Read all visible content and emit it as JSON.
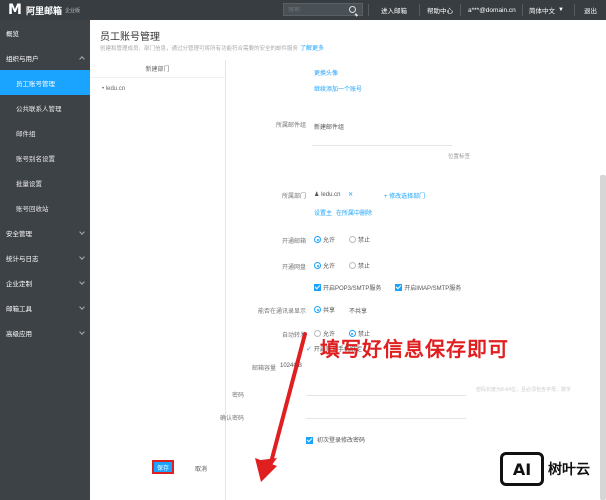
{
  "topbar": {
    "logo_mark": "M",
    "brand": "阿里邮箱",
    "edition": "企业版",
    "search_placeholder": "搜索",
    "nav": [
      "进入邮箱",
      "帮助中心",
      "a***@domain.cn",
      "简体中文",
      "退出"
    ]
  },
  "sidebar": {
    "items": [
      {
        "label": "概览"
      },
      {
        "label": "组织与用户",
        "expanded": true
      },
      {
        "label": "员工账号管理",
        "active": true
      },
      {
        "label": "公共联系人管理"
      },
      {
        "label": "邮件组"
      },
      {
        "label": "账号别名设置"
      },
      {
        "label": "批量设置"
      },
      {
        "label": "账号回收站"
      },
      {
        "label": "安全管理"
      },
      {
        "label": "统计与日志"
      },
      {
        "label": "企业定制"
      },
      {
        "label": "邮箱工具"
      },
      {
        "label": "高级应用"
      }
    ]
  },
  "main": {
    "title": "员工账号管理",
    "desc": "创建和管理成员、部门信息，通过分管理可将所有功能符合需要的安全的邮件服务",
    "desc_link": "了解更多",
    "dept_header": "新建部门",
    "dept_tree_root": "ledu.cn",
    "links_top": [
      "更换头像",
      "继续添加一个账号"
    ],
    "belong_label": "所属邮件组",
    "belong_value": "新建邮件组",
    "right_hint": "位置标签",
    "dept_label": "所属部门",
    "dept_value": "ledu.cn",
    "dept_link": "+ 修改选择部门",
    "dept_sublinks": [
      "设置主",
      "在所属中删除"
    ],
    "options": [
      {
        "label": "开通邮箱",
        "yes": "允许",
        "no": "禁止"
      },
      {
        "label": "开通网盘",
        "yes": "允许",
        "no": "禁止"
      }
    ],
    "protocols": [
      "开启POP3/SMTP服务",
      "开启IMAP/SMTP服务"
    ],
    "share_label": "能否在通讯录显示",
    "share_yes": "共享",
    "share_no": "不共享",
    "auto_label": "自动转发",
    "auto_yes": "允许",
    "auto_no": "禁止",
    "auto_check": "开启账号手机绑定",
    "quota_label": "邮箱容量",
    "quota_value": "1024GB",
    "password_label": "密码",
    "confirm_label": "确认密码",
    "pwd_hint": "密码长度为8-64位，且必须包含字母、数字",
    "first_login_label": "初次登录修改密码",
    "save": "保存",
    "cancel": "取消"
  },
  "annotation": "填写好信息保存即可",
  "watermark": {
    "mark": "AI",
    "text": "树叶云"
  }
}
